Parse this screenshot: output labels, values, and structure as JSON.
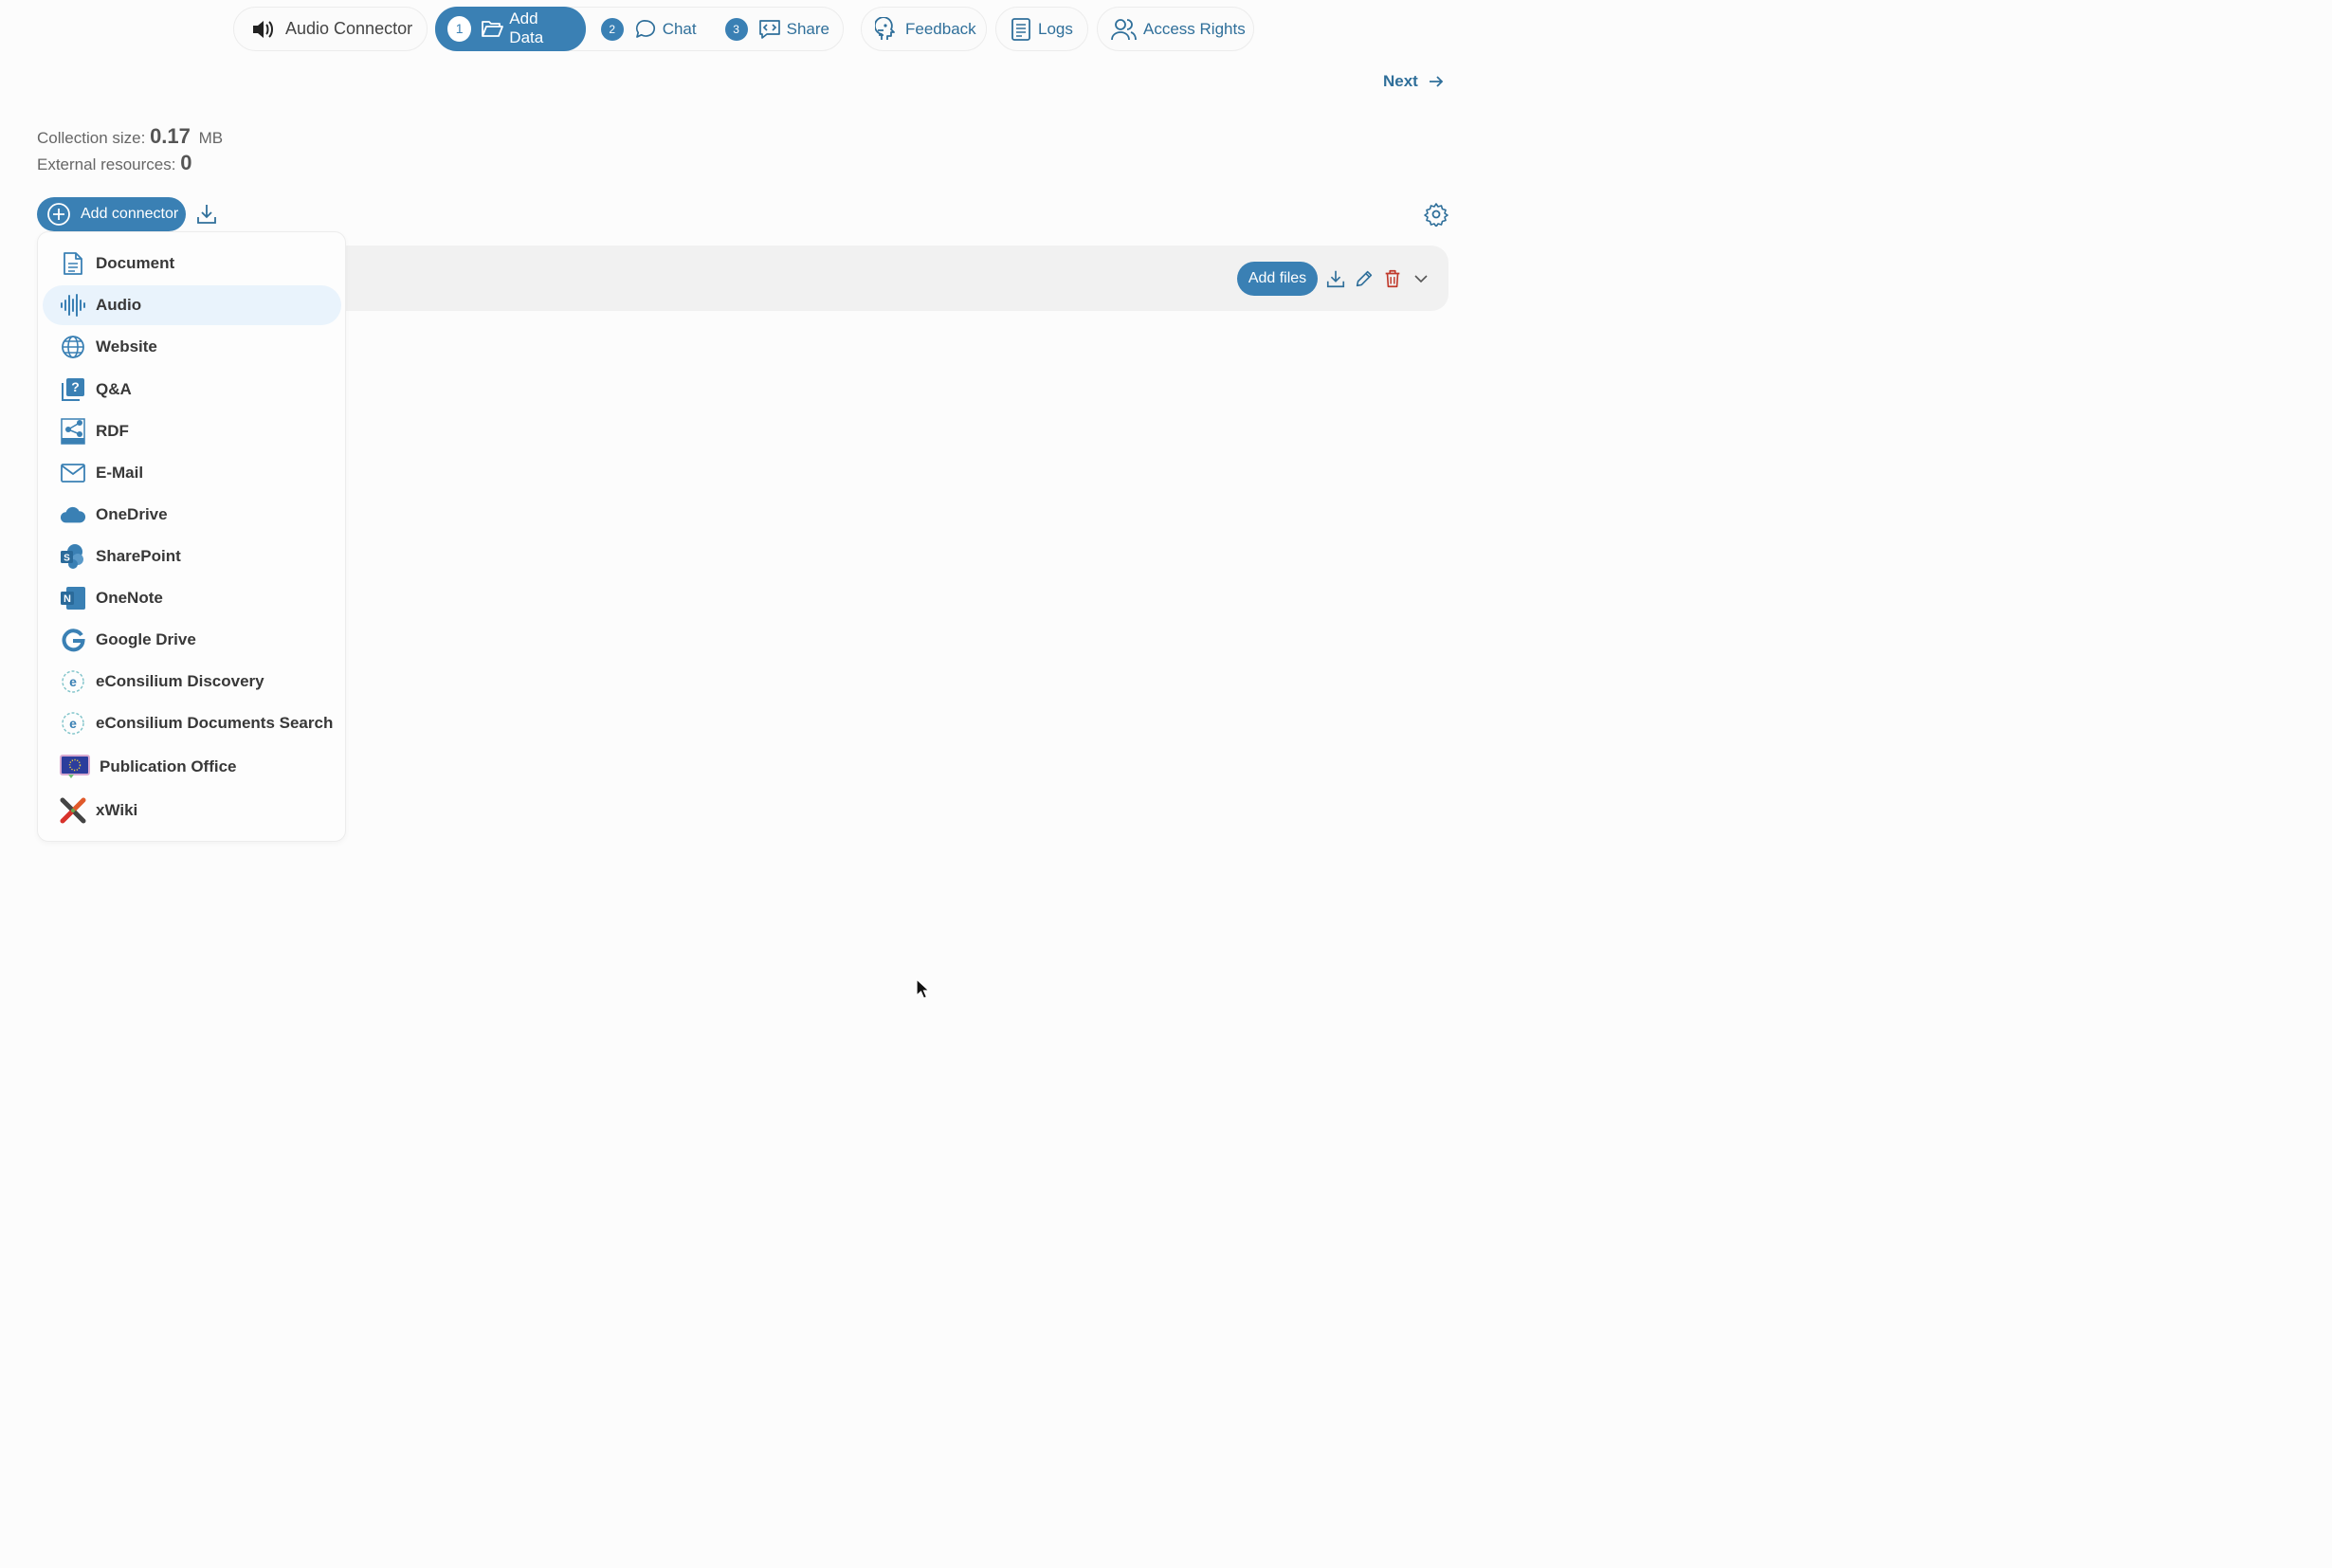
{
  "app": {
    "title": "Audio Connector"
  },
  "steps": [
    {
      "num": "1",
      "label": "Add Data",
      "active": true
    },
    {
      "num": "2",
      "label": "Chat",
      "active": false
    },
    {
      "num": "3",
      "label": "Share",
      "active": false
    }
  ],
  "toolbar": {
    "feedback": "Feedback",
    "logs": "Logs",
    "access_rights": "Access Rights"
  },
  "nav": {
    "next": "Next"
  },
  "stats": {
    "size_label": "Collection size:",
    "size_value": "0.17",
    "size_unit": "MB",
    "external_label": "External resources:",
    "external_value": "0"
  },
  "actions": {
    "add_connector": "Add connector",
    "add_files": "Add files"
  },
  "menu": {
    "items": [
      {
        "label": "Document",
        "icon": "document-icon"
      },
      {
        "label": "Audio",
        "icon": "audio-waveform-icon",
        "highlighted": true
      },
      {
        "label": "Website",
        "icon": "globe-icon"
      },
      {
        "label": "Q&A",
        "icon": "question-icon"
      },
      {
        "label": "RDF",
        "icon": "rdf-icon"
      },
      {
        "label": "E-Mail",
        "icon": "mail-icon"
      },
      {
        "label": "OneDrive",
        "icon": "cloud-icon"
      },
      {
        "label": "SharePoint",
        "icon": "sharepoint-icon"
      },
      {
        "label": "OneNote",
        "icon": "onenote-icon"
      },
      {
        "label": "Google Drive",
        "icon": "google-g-icon"
      },
      {
        "label": "eConsilium Discovery",
        "icon": "econsilium-icon"
      },
      {
        "label": "eConsilium Documents Search",
        "icon": "econsilium-icon"
      },
      {
        "label": "Publication Office",
        "icon": "eu-flag-icon"
      },
      {
        "label": "xWiki",
        "icon": "xwiki-icon"
      }
    ]
  },
  "colors": {
    "primary": "#3a80b4",
    "link": "#2f6f9a",
    "danger": "#c0392b",
    "highlight": "#e9f3fc"
  }
}
